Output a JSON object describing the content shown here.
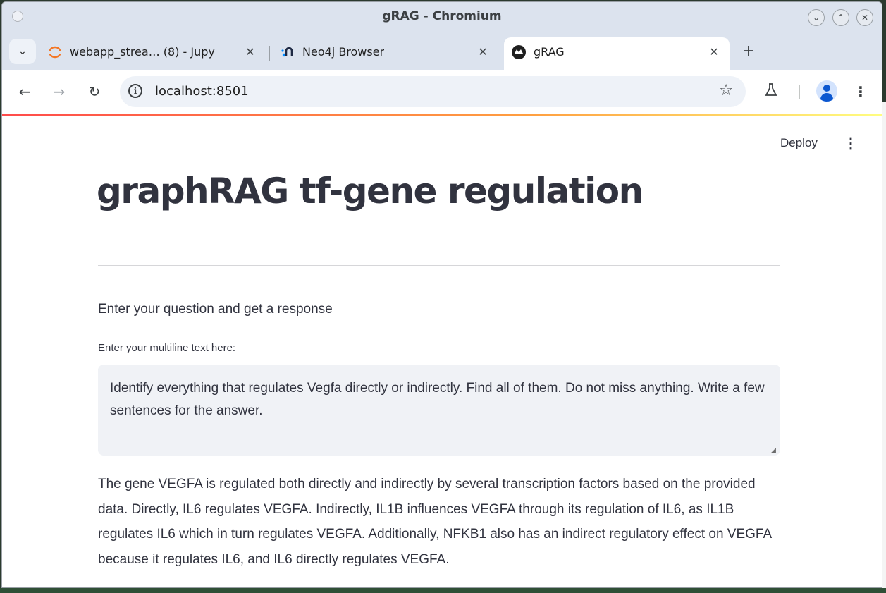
{
  "window": {
    "title": "gRAG - Chromium"
  },
  "tabs": [
    {
      "label": "webapp_strea… (8) - Jupy",
      "icon": "jupyter-icon",
      "active": false
    },
    {
      "label": "Neo4j Browser",
      "icon": "neo4j-icon",
      "active": false
    },
    {
      "label": "gRAG",
      "icon": "streamlit-icon",
      "active": true
    }
  ],
  "toolbar": {
    "url": "localhost:8501"
  },
  "app": {
    "deploy_label": "Deploy",
    "title": "graphRAG tf-gene regulation",
    "subheader": "Enter your question and get a response",
    "input_label": "Enter your multiline text here:",
    "input_value": "Identify everything that regulates Vegfa directly or indirectly. Find all of them. Do not miss anything. Write a few sentences for the answer.",
    "response": "The gene VEGFA is regulated both directly and indirectly by several transcription factors based on the provided data. Directly, IL6 regulates VEGFA. Indirectly, IL1B influences VEGFA through its regulation of IL6, as IL1B regulates IL6 which in turn regulates VEGFA. Additionally, NFKB1 also has an indirect regulatory effect on VEGFA because it regulates IL6, and IL6 directly regulates VEGFA."
  },
  "colors": {
    "accent_gradient_start": "#ff4b4b",
    "accent_gradient_end": "#fffd80",
    "text": "#31333f",
    "input_bg": "#f0f2f6",
    "chrome_frame": "#dce3ee"
  }
}
